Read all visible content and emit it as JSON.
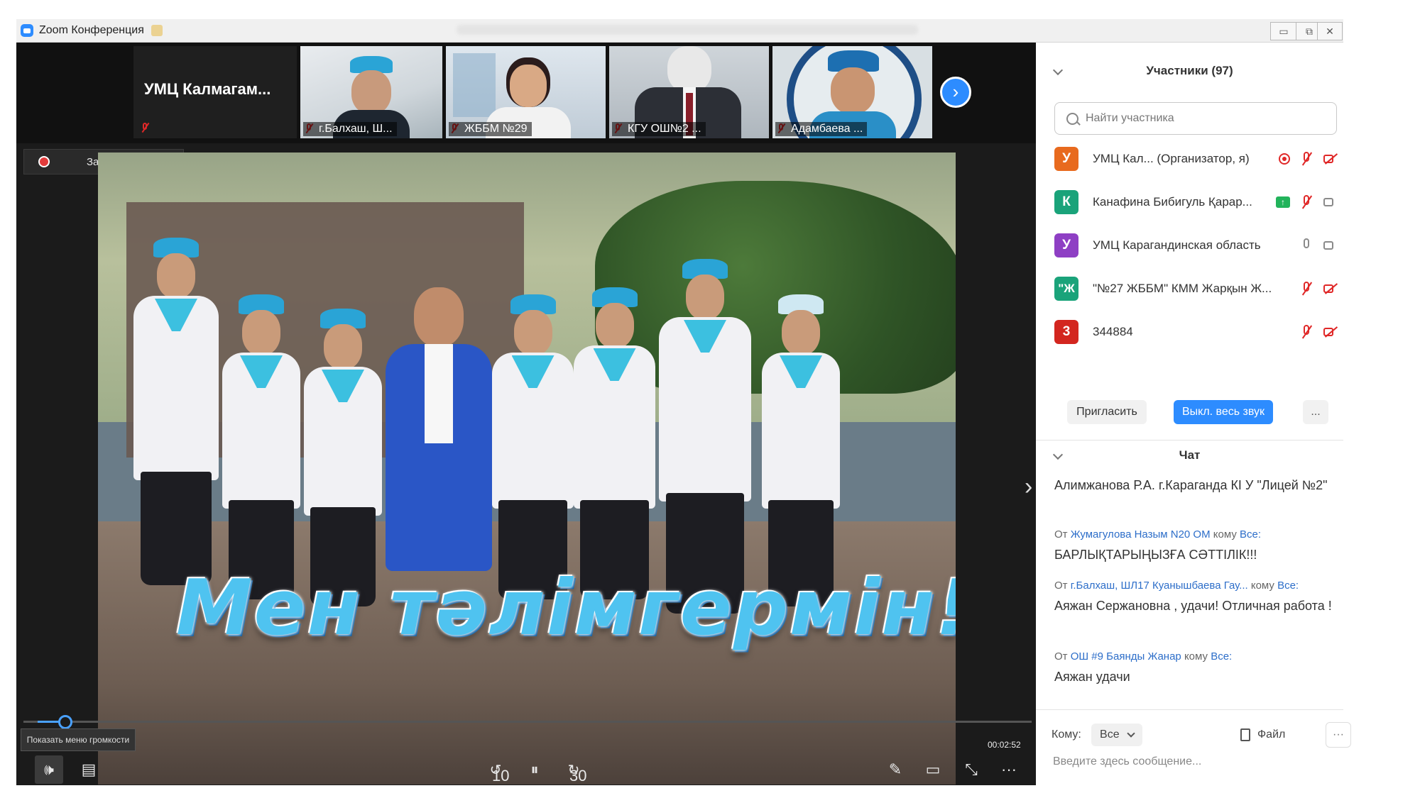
{
  "window": {
    "title": "Zoom Конференция",
    "min_btn": "▭",
    "max_btn": "⧉",
    "close_btn": "✕"
  },
  "gallery": {
    "self_tile_name": "УМЦ  Калмагам...",
    "tiles": [
      {
        "name": "г.Балхаш, Ш...",
        "muted": true
      },
      {
        "name": "ЖББМ №29",
        "muted": true
      },
      {
        "name": "КГУ ОШ№2 ...",
        "muted": true
      },
      {
        "name": "Адамбаева ...",
        "muted": true
      }
    ],
    "next_icon": "chevron-right-icon"
  },
  "recording": {
    "label": "Запись..."
  },
  "shared_video": {
    "overlay_title": "Мен тәлімгермін!",
    "timecode": "00:02:52",
    "volume_tooltip": "Показать меню громкости"
  },
  "participants": {
    "header": "Участники (97)",
    "search_placeholder": "Найти участника",
    "list": [
      {
        "initial": "У",
        "color": "#e86a1e",
        "name": "УМЦ Кал... (Организатор, я)",
        "badge": "recording",
        "mic": "muted",
        "cam": "off"
      },
      {
        "initial": "К",
        "color": "#1aa37a",
        "name": "Канафина Бибигуль Қарар...",
        "badge": "share",
        "mic": "muted",
        "cam": "on"
      },
      {
        "initial": "У",
        "color": "#8e3fc4",
        "name": "УМЦ Карагандинская область",
        "badge": "",
        "mic": "on",
        "cam": "on"
      },
      {
        "initial": "\"Ж",
        "color": "#1aa37a",
        "name": "\"№27 ЖББМ\" КММ Жарқын Ж...",
        "badge": "",
        "mic": "muted",
        "cam": "off"
      },
      {
        "initial": "3",
        "color": "#d3261f",
        "name": "344884",
        "badge": "",
        "mic": "muted",
        "cam": "off"
      }
    ],
    "invite_label": "Пригласить",
    "mute_all_label": "Выкл. весь звук",
    "more_label": "..."
  },
  "chat": {
    "header": "Чат",
    "messages": [
      {
        "from": "",
        "to": "",
        "text": "Алимжанова Р.А. г.Караганда КІ У \"Лицей  №2\""
      },
      {
        "from": "Жумагулова Назым   N20 ОМ",
        "to": "Все:",
        "text": "БАРЛЫҚТАРЫҢЫЗҒА СӘТТІЛІК!!!"
      },
      {
        "from": "г.Балхаш, ШЛ17 Куанышбаева Гау...",
        "to": "Все:",
        "text": "Аяжан Сержановна , удачи! Отличная работа !"
      },
      {
        "from": "ОШ #9 Баянды Жанар",
        "to": "Все:",
        "text": "Аяжан удачи"
      }
    ],
    "from_word": "От",
    "to_word": "кому",
    "recipient_label": "Кому:",
    "recipient_value": "Все",
    "file_label": "Файл",
    "more_label": "···",
    "input_placeholder": "Введите здесь сообщение..."
  },
  "controls": {
    "volume_icon": "🕪",
    "chat_icon": "▤",
    "rewind_label": "10",
    "forward_label": "30",
    "pause_icon": "⏸",
    "pen_icon": "✎",
    "cc_icon": "▭",
    "fullscreen_icon": "⤡",
    "more_icon": "···"
  },
  "colors": {
    "accent": "#2d8cff",
    "mute_red": "#e02828"
  }
}
